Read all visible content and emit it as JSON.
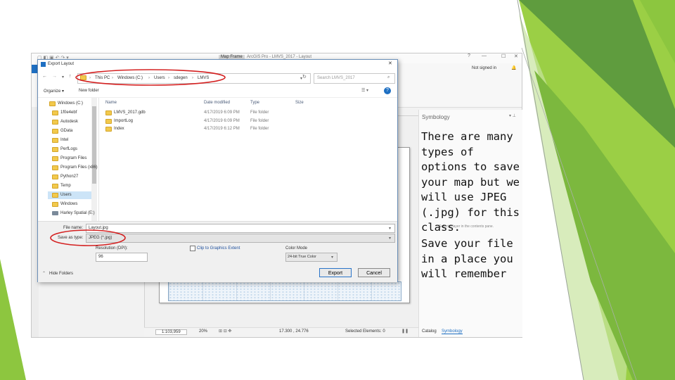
{
  "app": {
    "title": "ArcGIS Pro - LMVS_2017 - Layout",
    "context_tab": "Map Frame",
    "user": "Not signed in",
    "symbology_title": "Symbology",
    "symbology_hint": "Select a layer in the contents pane.",
    "catalog_tab": "Catalog",
    "symbology_tab": "Symbology",
    "scale": "1:103,959",
    "zoom": "20%",
    "coords": "17.300 , 24.776",
    "selected": "Selected Elements: 0"
  },
  "dialog": {
    "title": "Export Layout",
    "path": [
      "This PC",
      "Windows (C:)",
      "Users",
      "sdegen",
      "LMVS"
    ],
    "search_placeholder": "Search LMVS_2017",
    "organize": "Organize ▾",
    "new_folder": "New folder",
    "columns": [
      "Name",
      "Date modified",
      "Type",
      "Size"
    ],
    "files": [
      {
        "name": "LMVS_2017.gdb",
        "date": "4/17/2019 6:09 PM",
        "type": "File folder"
      },
      {
        "name": "ImportLog",
        "date": "4/17/2019 6:09 PM",
        "type": "File folder"
      },
      {
        "name": "Index",
        "date": "4/17/2019 6:12 PM",
        "type": "File folder"
      }
    ],
    "nav": [
      "Windows (C:)",
      "1f0e4ebf",
      "Autodesk",
      "GData",
      "Intel",
      "PerfLogs",
      "Program Files",
      "Program Files (x86)",
      "Python27",
      "Temp",
      "Users",
      "Windows",
      "Harley Spatial (E:)"
    ],
    "file_name_label": "File name:",
    "file_name": "Layout.jpg",
    "save_type_label": "Save as type:",
    "save_type": "JPEG (*.jpg)",
    "resolution_label": "Resolution (DPI):",
    "resolution": "96",
    "clip_label": "Clip to Graphics Extent",
    "color_mode_label": "Color Mode",
    "color_mode": "24-bit True Color",
    "hide_folders": "Hide Folders",
    "export": "Export",
    "cancel": "Cancel"
  },
  "notes": {
    "p1": "There are many types of options to save your map but we will use JPEG (.jpg) for this class.",
    "p2": "Save your file in a place you will remember"
  },
  "colors": {
    "green_dark": "#5e9b3c",
    "green_mid": "#7fba3c",
    "green_light": "#a6d04a",
    "annotation_red": "#d42020",
    "accent_blue": "#1e6fc2"
  }
}
